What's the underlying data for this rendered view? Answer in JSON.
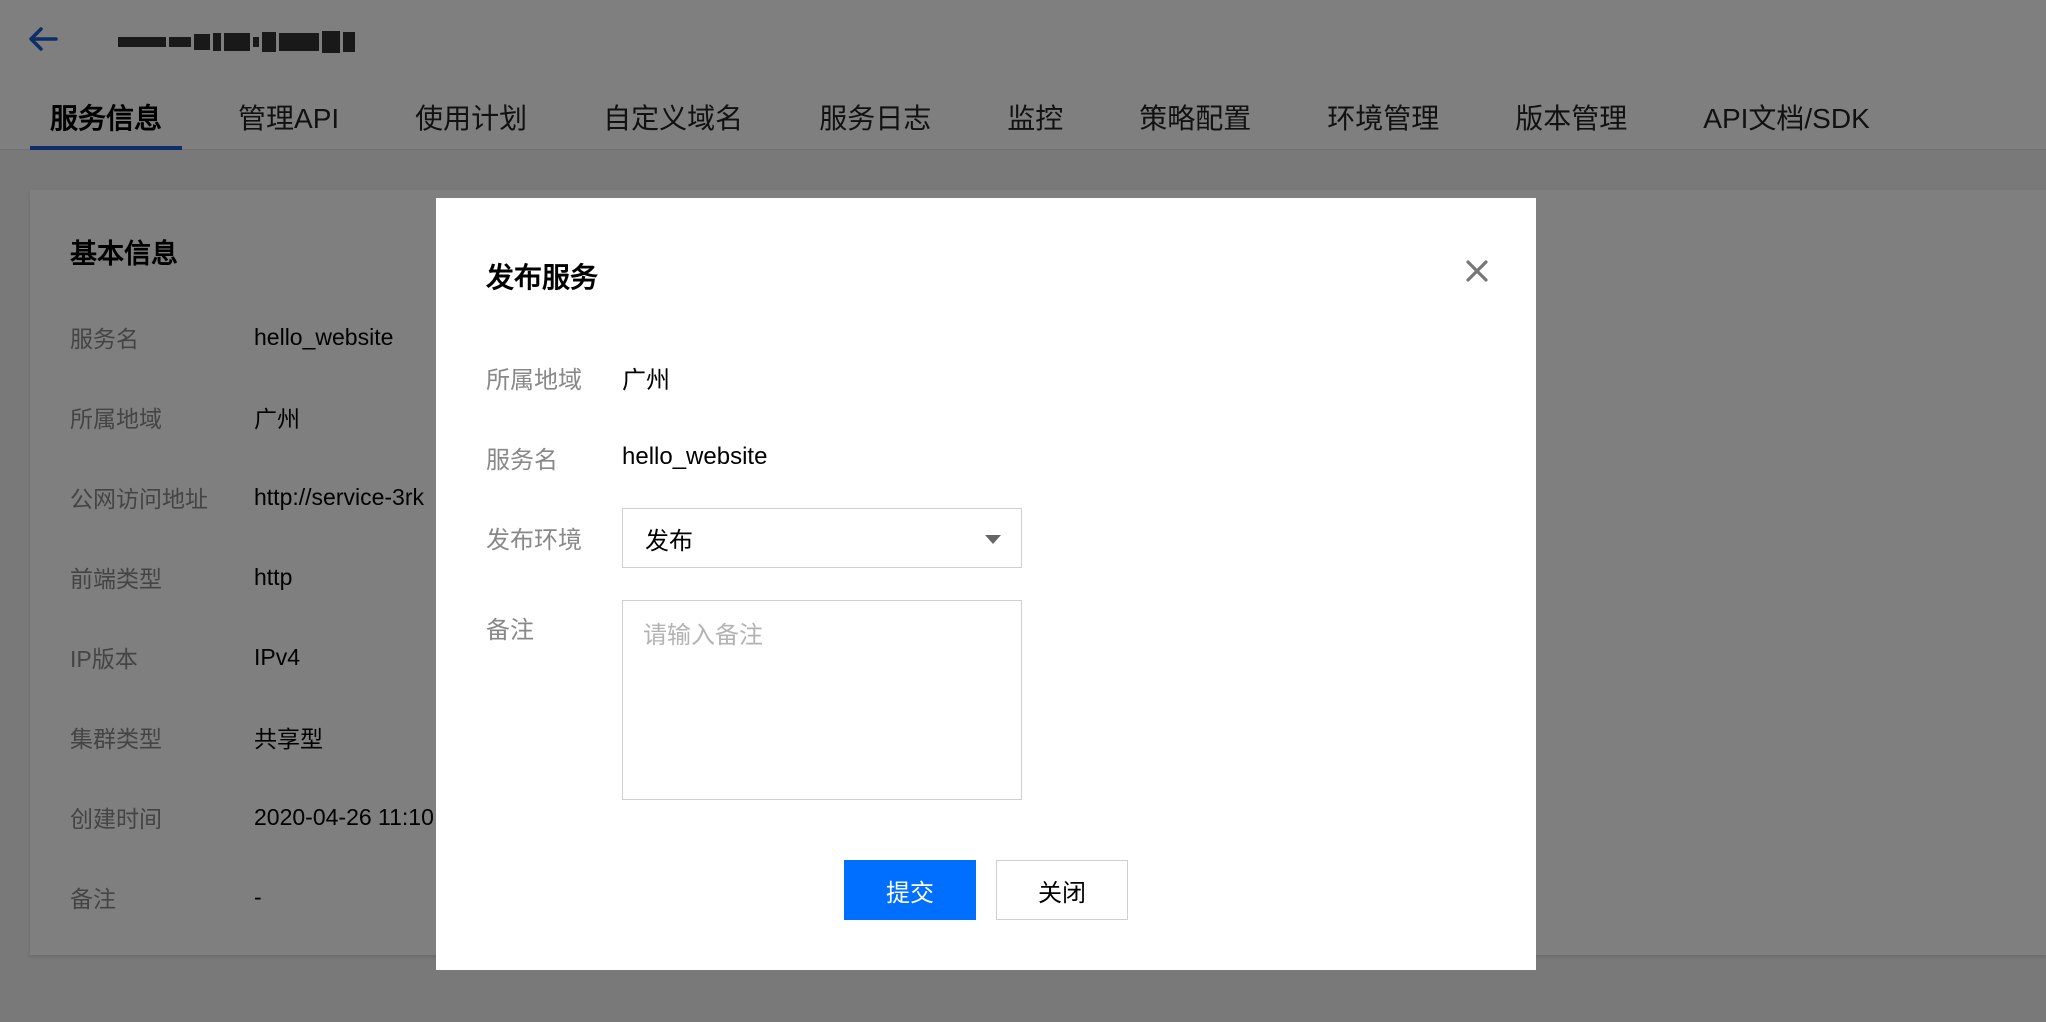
{
  "header": {
    "back_icon": "arrow-left-icon",
    "accent_color": "#1a5ccf"
  },
  "tabs": [
    {
      "label": "服务信息",
      "active": true
    },
    {
      "label": "管理API",
      "active": false
    },
    {
      "label": "使用计划",
      "active": false
    },
    {
      "label": "自定义域名",
      "active": false
    },
    {
      "label": "服务日志",
      "active": false
    },
    {
      "label": "监控",
      "active": false
    },
    {
      "label": "策略配置",
      "active": false
    },
    {
      "label": "环境管理",
      "active": false
    },
    {
      "label": "版本管理",
      "active": false
    },
    {
      "label": "API文档/SDK",
      "active": false
    }
  ],
  "basic_info": {
    "title": "基本信息",
    "rows": [
      {
        "label": "服务名",
        "value": "hello_website"
      },
      {
        "label": "所属地域",
        "value": "广州"
      },
      {
        "label": "公网访问地址",
        "value": "http://service-3rk"
      },
      {
        "label": "前端类型",
        "value": "http"
      },
      {
        "label": "IP版本",
        "value": "IPv4"
      },
      {
        "label": "集群类型",
        "value": "共享型"
      },
      {
        "label": "创建时间",
        "value": "2020-04-26 11:10"
      },
      {
        "label": "备注",
        "value": "-"
      }
    ]
  },
  "modal": {
    "title": "发布服务",
    "close_icon": "close-icon",
    "region_label": "所属地域",
    "region_value": "广州",
    "service_label": "服务名",
    "service_value": "hello_website",
    "env_label": "发布环境",
    "env_selected": "发布",
    "remark_label": "备注",
    "remark_placeholder": "请输入备注",
    "remark_value": "",
    "submit_label": "提交",
    "close_label": "关闭",
    "primary_color": "#006eff"
  }
}
